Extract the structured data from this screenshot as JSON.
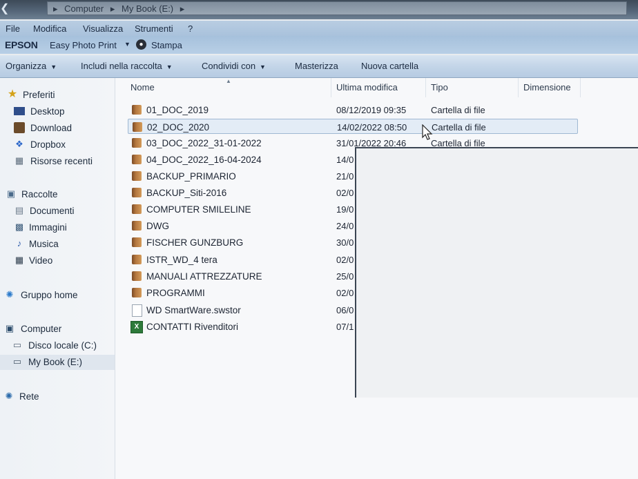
{
  "address": {
    "crumbs": [
      "Computer",
      "My Book (E:)"
    ]
  },
  "menu": {
    "items": [
      "File",
      "Modifica",
      "Visualizza",
      "Strumenti",
      "?"
    ]
  },
  "epson": {
    "logo": "EPSON",
    "app": "Easy Photo Print",
    "print": "Stampa"
  },
  "toolbar": {
    "organize": "Organizza",
    "include": "Includi nella raccolta",
    "share": "Condividi con",
    "burn": "Masterizza",
    "new_folder": "Nuova cartella"
  },
  "nav": {
    "favorites": "Preferiti",
    "desktop": "Desktop",
    "download": "Download",
    "dropbox": "Dropbox",
    "recent": "Risorse recenti",
    "libraries": "Raccolte",
    "documents": "Documenti",
    "images": "Immagini",
    "music": "Musica",
    "video": "Video",
    "homegroup": "Gruppo home",
    "computer": "Computer",
    "local_disk": "Disco locale (C:)",
    "mybook": "My Book (E:)",
    "network": "Rete"
  },
  "columns": {
    "name": "Nome",
    "modified": "Ultima modifica",
    "type": "Tipo",
    "size": "Dimensione"
  },
  "files": [
    {
      "name": "01_DOC_2019",
      "date": "08/12/2019 09:35",
      "type": "Cartella di file"
    },
    {
      "name": "02_DOC_2020",
      "date": "14/02/2022 08:50",
      "type": "Cartella di file"
    },
    {
      "name": "03_DOC_2022_31-01-2022",
      "date": "31/01/2022 20:46",
      "type": "Cartella di file"
    },
    {
      "name": "04_DOC_2022_16-04-2024",
      "date": "14/0",
      "type": ""
    },
    {
      "name": "BACKUP_PRIMARIO",
      "date": "21/0",
      "type": ""
    },
    {
      "name": "BACKUP_Siti-2016",
      "date": "02/0",
      "type": ""
    },
    {
      "name": "COMPUTER SMILELINE",
      "date": "19/0",
      "type": ""
    },
    {
      "name": "DWG",
      "date": "24/0",
      "type": ""
    },
    {
      "name": "FISCHER GUNZBURG",
      "date": "30/0",
      "type": ""
    },
    {
      "name": "ISTR_WD_4 tera",
      "date": "02/0",
      "type": ""
    },
    {
      "name": "MANUALI ATTREZZATURE",
      "date": "25/0",
      "type": ""
    },
    {
      "name": "PROGRAMMI",
      "date": "02/0",
      "type": ""
    },
    {
      "name": "WD SmartWare.swstor",
      "date": "06/0",
      "type": ""
    },
    {
      "name": "CONTATTI Rivenditori",
      "date": "07/1",
      "type": ""
    }
  ],
  "colors": {
    "selection": "#e3ecf6",
    "toolbar": "#c3d5e8"
  }
}
